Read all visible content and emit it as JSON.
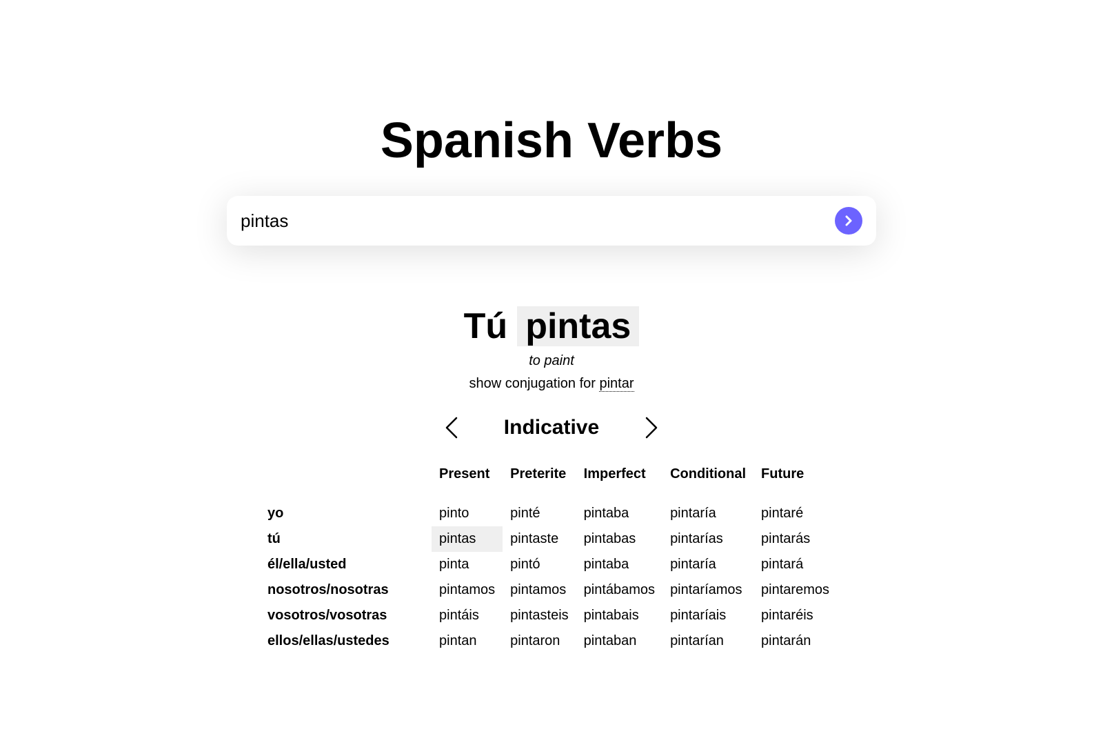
{
  "header": {
    "title": "Spanish Verbs"
  },
  "search": {
    "value": "pintas"
  },
  "result": {
    "pronoun": "Tú",
    "form": "pintas",
    "translation": "to paint",
    "show_conjugation_prefix": "show conjugation for",
    "infinitive": "pintar"
  },
  "mood": {
    "title": "Indicative"
  },
  "table": {
    "headers": [
      "Present",
      "Preterite",
      "Imperfect",
      "Conditional",
      "Future"
    ],
    "rows": [
      {
        "pronoun": "yo",
        "forms": [
          "pinto",
          "pinté",
          "pintaba",
          "pintaría",
          "pintaré"
        ]
      },
      {
        "pronoun": "tú",
        "forms": [
          "pintas",
          "pintaste",
          "pintabas",
          "pintarías",
          "pintarás"
        ]
      },
      {
        "pronoun": "él/ella/usted",
        "forms": [
          "pinta",
          "pintó",
          "pintaba",
          "pintaría",
          "pintará"
        ]
      },
      {
        "pronoun": "nosotros/nosotras",
        "forms": [
          "pintamos",
          "pintamos",
          "pintábamos",
          "pintaríamos",
          "pintaremos"
        ]
      },
      {
        "pronoun": "vosotros/vosotras",
        "forms": [
          "pintáis",
          "pintasteis",
          "pintabais",
          "pintaríais",
          "pintaréis"
        ]
      },
      {
        "pronoun": "ellos/ellas/ustedes",
        "forms": [
          "pintan",
          "pintaron",
          "pintaban",
          "pintarían",
          "pintarán"
        ]
      }
    ]
  },
  "colors": {
    "accent": "#6c63ff",
    "highlight": "#efefef"
  },
  "icons": {
    "submit": "chevron-right-icon",
    "prev": "chevron-left-icon",
    "next": "chevron-right-icon"
  }
}
